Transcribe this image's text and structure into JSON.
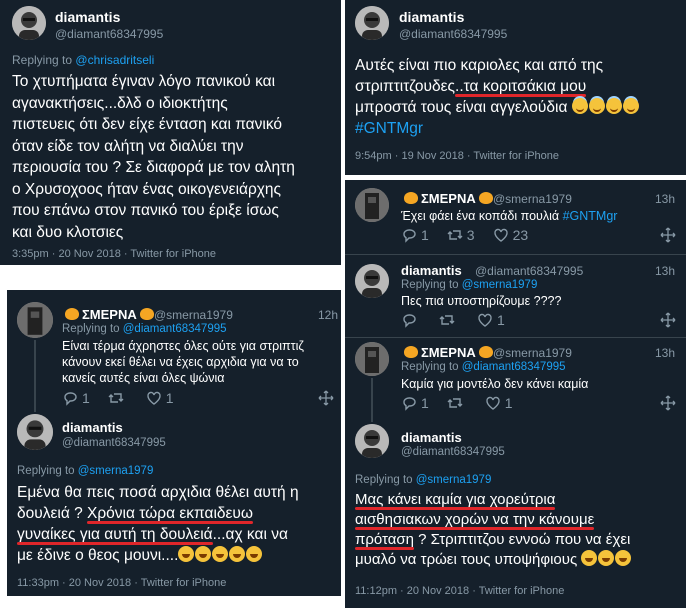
{
  "panel1": {
    "name": "diamantis",
    "handle": "@diamant68347995",
    "replying_prefix": "Replying to",
    "replying_to": "@chrisadritseli",
    "lines": [
      "Το χτυπήματα έγιναν λόγο πανικού και",
      "αγανακτήσεις...δλδ ο ιδιοκτήτης",
      "πιστευεις ότι δεν είχε ένταση και πανικό",
      "όταν είδε τον αλήτη να διαλύει την",
      "περιουσία του ? Σε διαφορά με τον αλητη",
      "ο Χρυσοχοος ήταν ένας οικογενειάρχης",
      "που επάνω στον πανικό του έριξε ίσως",
      "και δυο κλοτσιες"
    ],
    "meta": "3:35pm · 20 Nov 2018 · Twitter for iPhone"
  },
  "panel2": {
    "name": "diamantis",
    "handle": "@diamant68347995",
    "line1": "Αυτές είναι πιο καριολες και από της",
    "line2_a": "στριπτιτζουδες",
    "line2_b": "..τα κοριτσάκια μου",
    "line3": "μπροστά τους είναι αγγελούδια",
    "hashtag": "#GNTMgr",
    "meta": "9:54pm · 19 Nov 2018 · Twitter for iPhone"
  },
  "panel3": {
    "tweet1": {
      "name": "ΣΜΕΡΝΑ",
      "handle": "@smerna1979",
      "time": "13h",
      "text": "Έχει φάει ένα κοπάδι πουλιά",
      "hashtag": "#GNTMgr",
      "replies": "1",
      "retweets": "3",
      "likes": "23"
    },
    "tweet2": {
      "name": "diamantis",
      "handle": "@diamant68347995",
      "time": "13h",
      "replying_prefix": "Replying to",
      "replying_to": "@smerna1979",
      "text": "Πες πια υποστηρίζουμε ????",
      "replies": "",
      "retweets": "",
      "likes": "1"
    },
    "tweet3": {
      "name": "ΣΜΕΡΝΑ",
      "handle": "@smerna1979",
      "time": "13h",
      "replying_prefix": "Replying to",
      "replying_to": "@diamant68347995",
      "text": "Καμία για μοντέλο δεν κάνει καμία",
      "replies": "1",
      "retweets": "",
      "likes": "1"
    },
    "tweet4": {
      "name": "diamantis",
      "handle": "@diamant68347995",
      "replying_prefix": "Replying to",
      "replying_to": "@smerna1979",
      "line1": "Μας κάνει καμία για χορεύτρια",
      "line2": "αισθησιακων χορών να την κάνουμε",
      "line3_a": "πρόταση",
      "line3_b": " ? Στριπτιτζου εννοώ που να έχει",
      "line4": "μυαλό να τρώει τους υποψήφιους",
      "meta": "11:12pm · 20 Nov 2018 · Twitter for iPhone"
    }
  },
  "panel4": {
    "tweet1": {
      "name": "ΣΜΕΡΝΑ",
      "handle": "@smerna1979",
      "time": "12h",
      "replying_prefix": "Replying to",
      "replying_to": "@diamant68347995",
      "line1": "Είναι τέρμα άχρηστες όλες ούτε για στριπτιζ",
      "line2": "κάνουν εκεί θέλει να έχεις αρχιδια για να το",
      "line3": "κανείς αυτές είναι όλες ψώνια",
      "replies": "1",
      "retweets": "",
      "likes": "1"
    },
    "tweet2": {
      "name": "diamantis",
      "handle": "@diamant68347995",
      "replying_prefix": "Replying to",
      "replying_to": "@smerna1979",
      "line1": "Εμένα θα πεις ποσά αρχιδια θέλει αυτή η",
      "line2_a": "δουλειά ? ",
      "line2_b": "Χρόνια τώρα εκπαιδευω",
      "line3_a": "γυναίκες για αυτή τη δουλειά",
      "line3_b": "...αχ και να",
      "line4": "με έδινε ο θεος μουνι....",
      "meta": "11:33pm · 20 Nov 2018 · Twitter for iPhone"
    }
  },
  "colors": {
    "background": "#15202b",
    "link": "#1da1f2",
    "muted": "#8899a6",
    "underline": "#e0262a"
  }
}
